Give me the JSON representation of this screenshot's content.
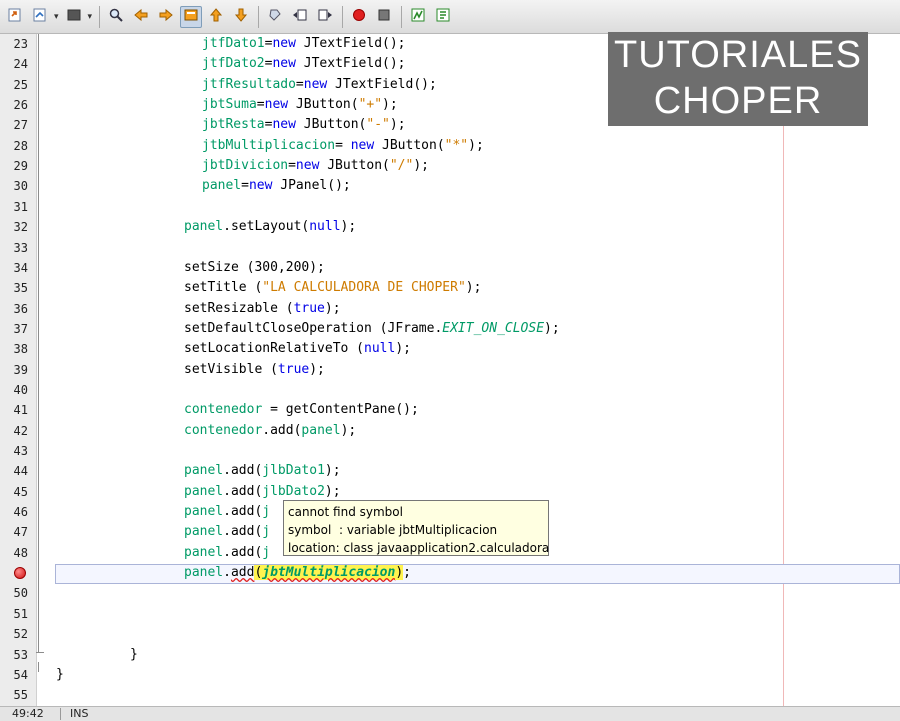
{
  "toolbar": {
    "buttons": [
      {
        "icon": "open-source-icon"
      },
      {
        "icon": "history-icon",
        "dropdown": true
      },
      {
        "icon": "back-icon",
        "dropdown": true
      },
      {
        "icon": "find-icon"
      },
      {
        "icon": "previous-occurrence-icon"
      },
      {
        "icon": "next-occurrence-icon"
      },
      {
        "icon": "toggle-highlight-icon",
        "active": true
      },
      {
        "icon": "previous-bookmark-icon"
      },
      {
        "icon": "next-bookmark-icon"
      },
      {
        "icon": "toggle-bookmark-icon"
      },
      {
        "icon": "shift-left-icon"
      },
      {
        "icon": "shift-right-icon"
      },
      {
        "icon": "start-macro-icon"
      },
      {
        "icon": "stop-macro-icon"
      },
      {
        "icon": "diff-icon"
      },
      {
        "icon": "comment-icon"
      }
    ]
  },
  "watermark": {
    "line1": "TUTORIALES",
    "line2": "CHOPER"
  },
  "editor": {
    "lines": [
      {
        "n": "23",
        "indent": 202,
        "segments": [
          {
            "t": "jtfDato1",
            "c": "fld"
          },
          {
            "t": "="
          },
          {
            "t": "new",
            "c": "kw"
          },
          {
            "t": " JTextField();"
          }
        ]
      },
      {
        "n": "24",
        "indent": 202,
        "segments": [
          {
            "t": "jtfDato2",
            "c": "fld"
          },
          {
            "t": "="
          },
          {
            "t": "new",
            "c": "kw"
          },
          {
            "t": " JTextField();"
          }
        ]
      },
      {
        "n": "25",
        "indent": 202,
        "segments": [
          {
            "t": "jtfResultado",
            "c": "fld"
          },
          {
            "t": "="
          },
          {
            "t": "new",
            "c": "kw"
          },
          {
            "t": " JTextField();"
          }
        ]
      },
      {
        "n": "26",
        "indent": 202,
        "segments": [
          {
            "t": "jbtSuma",
            "c": "fld"
          },
          {
            "t": "="
          },
          {
            "t": "new",
            "c": "kw"
          },
          {
            "t": " JButton("
          },
          {
            "t": "\"+\"",
            "c": "str"
          },
          {
            "t": ");"
          }
        ]
      },
      {
        "n": "27",
        "indent": 202,
        "segments": [
          {
            "t": "jbtResta",
            "c": "fld"
          },
          {
            "t": "="
          },
          {
            "t": "new",
            "c": "kw"
          },
          {
            "t": " JButton("
          },
          {
            "t": "\"-\"",
            "c": "str"
          },
          {
            "t": ");"
          }
        ]
      },
      {
        "n": "28",
        "indent": 202,
        "segments": [
          {
            "t": "jtbMultiplicacion",
            "c": "fld"
          },
          {
            "t": "= "
          },
          {
            "t": "new",
            "c": "kw"
          },
          {
            "t": " JButton("
          },
          {
            "t": "\"*\"",
            "c": "str"
          },
          {
            "t": ");"
          }
        ]
      },
      {
        "n": "29",
        "indent": 202,
        "segments": [
          {
            "t": "jbtDivicion",
            "c": "fld"
          },
          {
            "t": "="
          },
          {
            "t": "new",
            "c": "kw"
          },
          {
            "t": " JButton("
          },
          {
            "t": "\"/\"",
            "c": "str"
          },
          {
            "t": ");"
          }
        ]
      },
      {
        "n": "30",
        "indent": 202,
        "segments": [
          {
            "t": "panel",
            "c": "fld"
          },
          {
            "t": "="
          },
          {
            "t": "new",
            "c": "kw"
          },
          {
            "t": " JPanel();"
          }
        ]
      },
      {
        "n": "31",
        "indent": 184,
        "segments": []
      },
      {
        "n": "32",
        "indent": 184,
        "segments": [
          {
            "t": "panel",
            "c": "fld"
          },
          {
            "t": ".setLayout("
          },
          {
            "t": "null",
            "c": "kw"
          },
          {
            "t": ");"
          }
        ]
      },
      {
        "n": "33",
        "indent": 184,
        "segments": []
      },
      {
        "n": "34",
        "indent": 184,
        "segments": [
          {
            "t": "setSize (300,200);"
          }
        ]
      },
      {
        "n": "35",
        "indent": 184,
        "segments": [
          {
            "t": "setTitle ("
          },
          {
            "t": "\"LA CALCULADORA DE CHOPER\"",
            "c": "str"
          },
          {
            "t": ");"
          }
        ]
      },
      {
        "n": "36",
        "indent": 184,
        "segments": [
          {
            "t": "setResizable ("
          },
          {
            "t": "true",
            "c": "kw"
          },
          {
            "t": ");"
          }
        ]
      },
      {
        "n": "37",
        "indent": 184,
        "segments": [
          {
            "t": "setDefaultCloseOperation (JFrame."
          },
          {
            "t": "EXIT_ON_CLOSE",
            "c": "cst"
          },
          {
            "t": ");"
          }
        ]
      },
      {
        "n": "38",
        "indent": 184,
        "segments": [
          {
            "t": "setLocationRelativeTo ("
          },
          {
            "t": "null",
            "c": "kw"
          },
          {
            "t": ");"
          }
        ]
      },
      {
        "n": "39",
        "indent": 184,
        "segments": [
          {
            "t": "setVisible ("
          },
          {
            "t": "true",
            "c": "kw"
          },
          {
            "t": ");"
          }
        ]
      },
      {
        "n": "40",
        "indent": 184,
        "segments": []
      },
      {
        "n": "41",
        "indent": 184,
        "segments": [
          {
            "t": "contenedor",
            "c": "fld"
          },
          {
            "t": " = getContentPane();"
          }
        ]
      },
      {
        "n": "42",
        "indent": 184,
        "segments": [
          {
            "t": "contenedor",
            "c": "fld"
          },
          {
            "t": ".add("
          },
          {
            "t": "panel",
            "c": "fld"
          },
          {
            "t": ");"
          }
        ]
      },
      {
        "n": "43",
        "indent": 184,
        "segments": []
      },
      {
        "n": "44",
        "indent": 184,
        "segments": [
          {
            "t": "panel",
            "c": "fld"
          },
          {
            "t": ".add("
          },
          {
            "t": "jlbDato1",
            "c": "fld"
          },
          {
            "t": ");"
          }
        ]
      },
      {
        "n": "45",
        "indent": 184,
        "segments": [
          {
            "t": "panel",
            "c": "fld"
          },
          {
            "t": ".add("
          },
          {
            "t": "jlbDato2",
            "c": "fld"
          },
          {
            "t": ");"
          }
        ]
      },
      {
        "n": "46",
        "indent": 184,
        "segments": [
          {
            "t": "panel",
            "c": "fld"
          },
          {
            "t": ".add("
          },
          {
            "t": "j",
            "c": "fld"
          }
        ]
      },
      {
        "n": "47",
        "indent": 184,
        "segments": [
          {
            "t": "panel",
            "c": "fld"
          },
          {
            "t": ".add("
          },
          {
            "t": "j",
            "c": "fld"
          }
        ]
      },
      {
        "n": "48",
        "indent": 184,
        "segments": [
          {
            "t": "panel",
            "c": "fld"
          },
          {
            "t": ".add("
          },
          {
            "t": "j",
            "c": "fld"
          }
        ]
      },
      {
        "n": "",
        "indent": 184,
        "error": true,
        "segments": [
          {
            "t": "panel",
            "c": "fld"
          },
          {
            "t": "."
          },
          {
            "t": "add",
            "c": "wavy"
          },
          {
            "t": "(",
            "c": "paren"
          },
          {
            "t": "jbtMultiplicacion",
            "c": "err"
          },
          {
            "t": ")",
            "c": "paren"
          },
          {
            "t": ";"
          }
        ]
      },
      {
        "n": "50",
        "indent": 184,
        "segments": []
      },
      {
        "n": "51",
        "indent": 184,
        "segments": []
      },
      {
        "n": "52",
        "indent": 184,
        "segments": []
      },
      {
        "n": "53",
        "indent": 130,
        "segments": [
          {
            "t": "}"
          }
        ]
      },
      {
        "n": "54",
        "indent": 56,
        "segments": [
          {
            "t": "}"
          }
        ]
      },
      {
        "n": "55",
        "indent": 56,
        "segments": []
      }
    ]
  },
  "tooltip": {
    "line1": "cannot find symbol",
    "line2": "symbol  : variable jbtMultiplicacion",
    "line3": "location: class javaapplication2.calculadora"
  },
  "statusbar": {
    "position": "49:42",
    "mode": "INS"
  }
}
